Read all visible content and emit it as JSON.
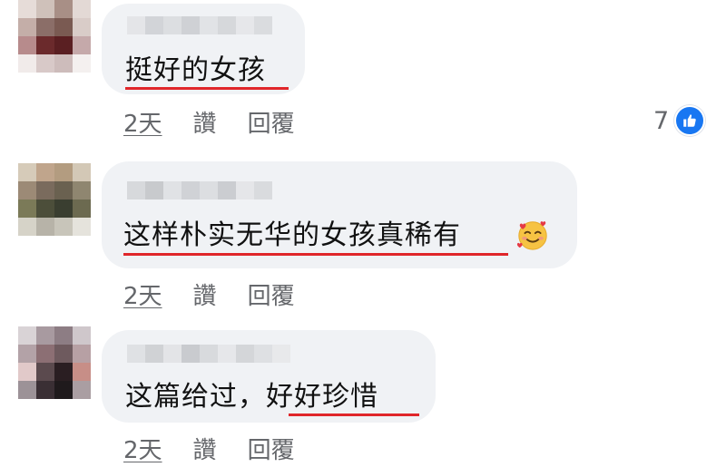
{
  "comments": [
    {
      "text": "挺好的女孩",
      "time": "2天",
      "like_label": "讚",
      "reply_label": "回覆",
      "reaction_count": "7",
      "reaction_icon": "thumbs-up-icon"
    },
    {
      "text": "这样朴实无华的女孩真稀有",
      "emoji": "smiling-face-with-hearts-icon",
      "time": "2天",
      "like_label": "讚",
      "reply_label": "回覆"
    },
    {
      "text": "这篇给过，好好珍惜",
      "time": "2天",
      "like_label": "讚",
      "reply_label": "回覆"
    }
  ],
  "colors": {
    "bubble": "#f0f2f5",
    "underline": "#e0262a",
    "meta_text": "#65676b",
    "like_blue": "#1877f2"
  }
}
